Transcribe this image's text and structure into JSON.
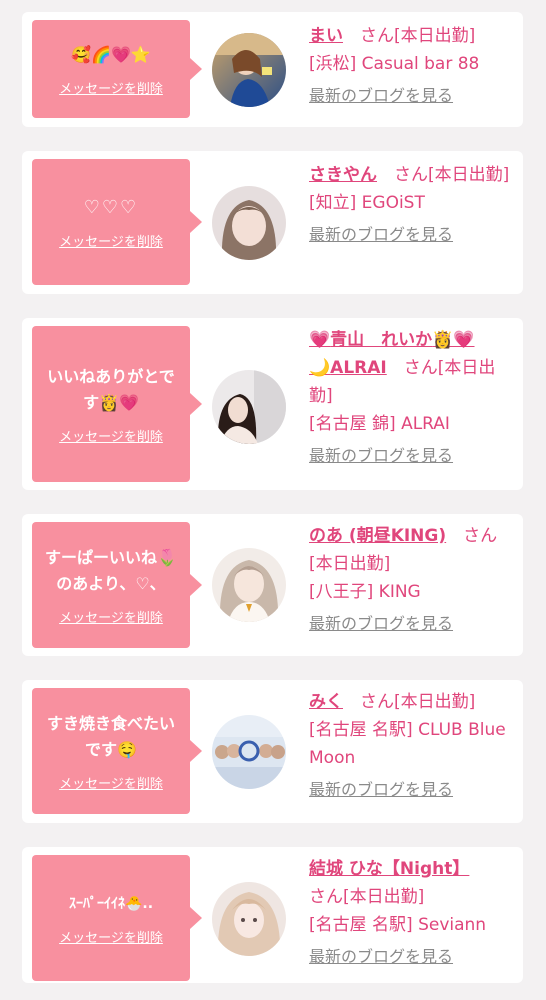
{
  "delete_label": "メッセージを削除",
  "blog_label": "最新のブログを見る",
  "colors": {
    "accent": "#e0467c",
    "bubble": "#f8909f",
    "background": "#f3f1f2",
    "muted": "#8a8a8a"
  },
  "cards": [
    {
      "message": "🥰🌈💗⭐",
      "name": "まい",
      "status": "さん[本日出勤]",
      "shop": "[浜松] Casual bar 88"
    },
    {
      "message": "♡♡♡",
      "name": "さきやん",
      "status": "さん[本日出勤]",
      "shop": "[知立] EGOiST"
    },
    {
      "message": "いいねありがとです👸💗",
      "name_prefix": "💗",
      "name": "青山　れいか",
      "name_mid": "👸💗",
      "name_moon": "🌙",
      "name_suffix": "ALRAI",
      "status": "さん[本日出勤]",
      "shop": "[名古屋 錦] ALRAI"
    },
    {
      "message": "すーぱーいいね🌷のあより、♡、",
      "name": "のあ (朝昼KING)",
      "status": "さん[本日出勤]",
      "shop": "[八王子] KING"
    },
    {
      "message": "すき焼き食べたいです🤤",
      "name": "みく",
      "status": "さん[本日出勤]",
      "shop": "[名古屋 名駅] CLUB Blue Moon"
    },
    {
      "message": "ｽｰﾊﾟｰｲｲﾈ🐣..",
      "name": "結城 ひな【Night】",
      "status": "さん[本日出勤]",
      "shop": "[名古屋 名駅] Seviann"
    }
  ]
}
